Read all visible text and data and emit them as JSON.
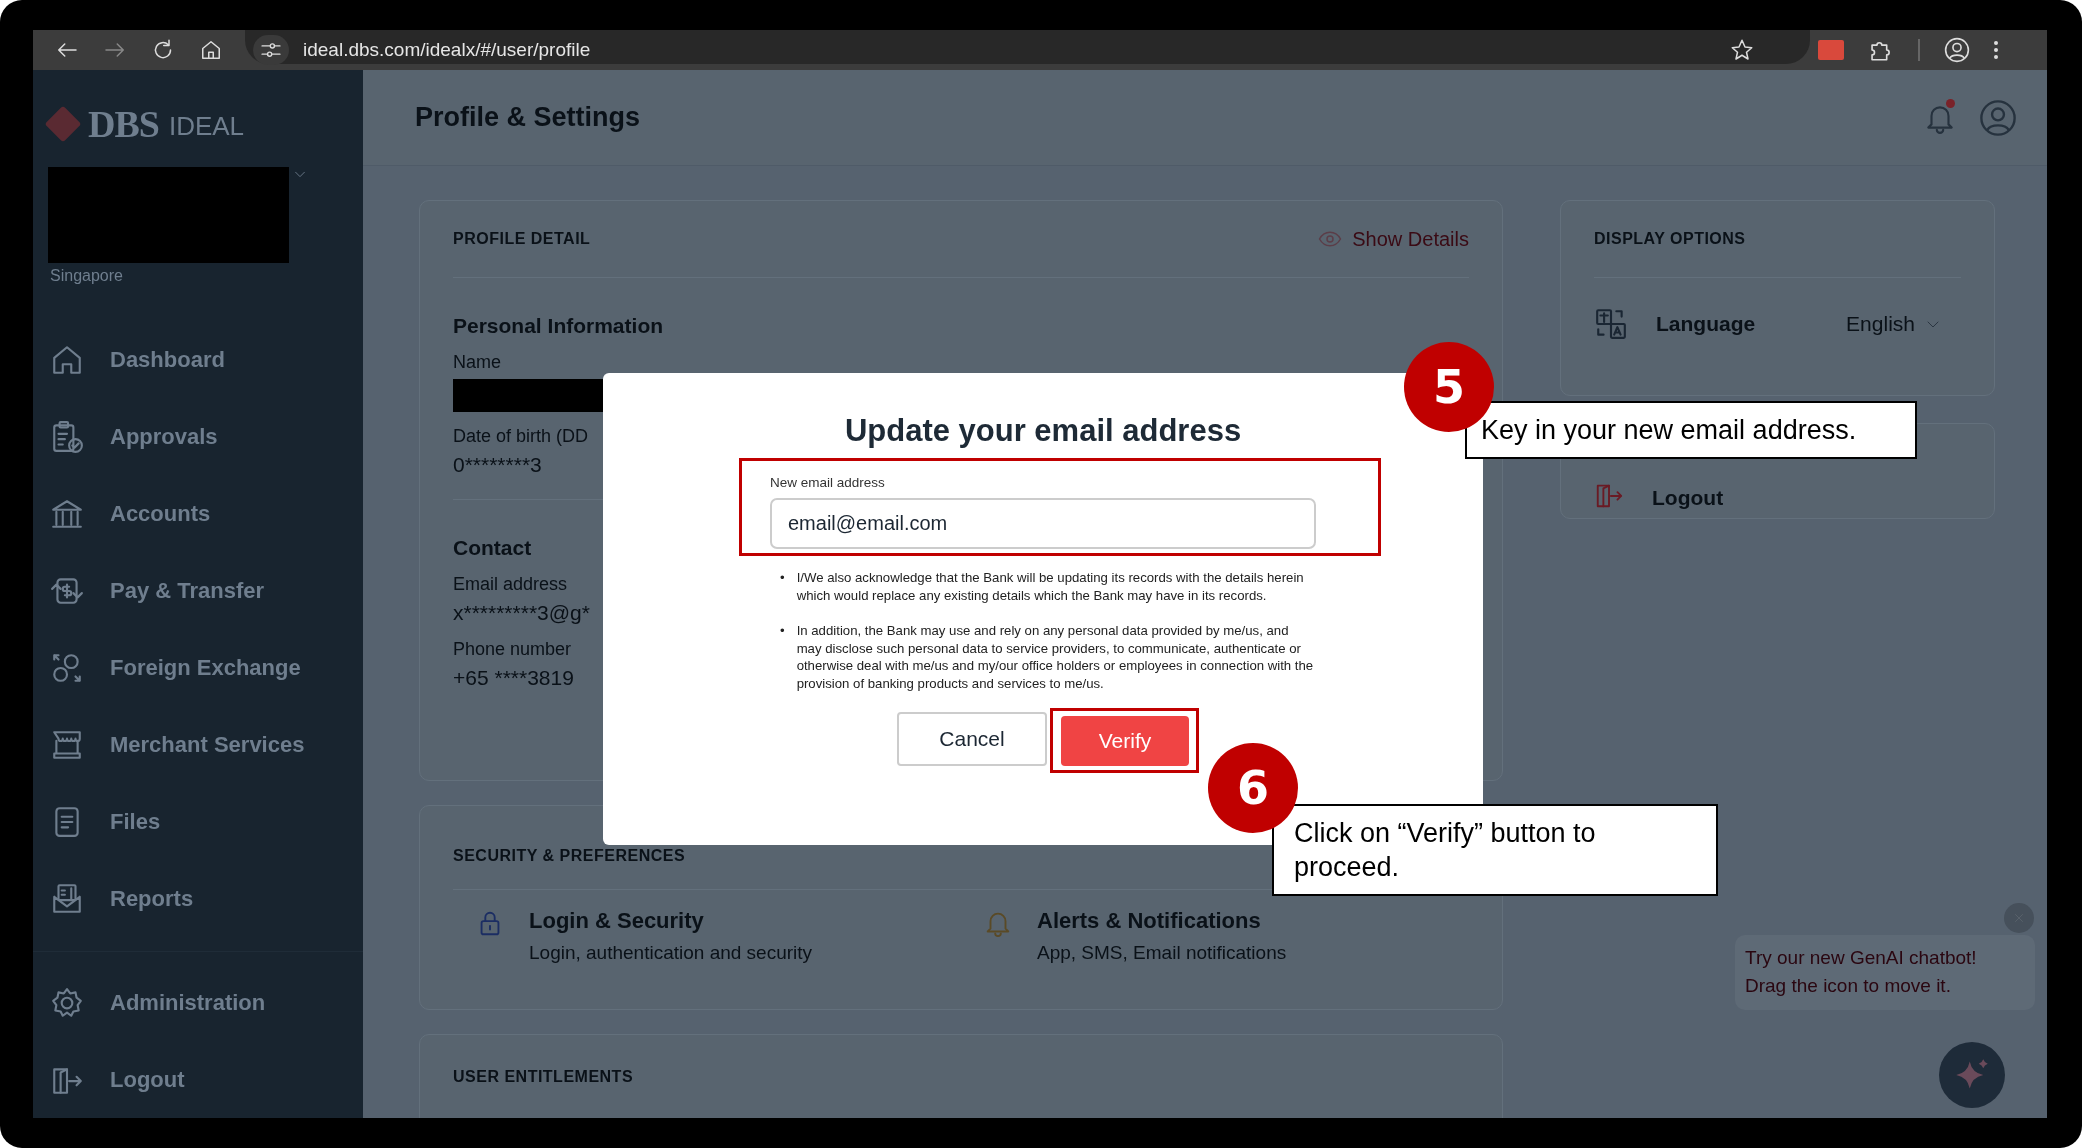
{
  "browser": {
    "url": "ideal.dbs.com/idealx/#/user/profile"
  },
  "sidebar": {
    "logo": {
      "brand": "DBS",
      "product": "IDEAL"
    },
    "account": {
      "redacted": true,
      "country": "Singapore"
    },
    "items": [
      {
        "label": "Dashboard"
      },
      {
        "label": "Approvals"
      },
      {
        "label": "Accounts"
      },
      {
        "label": "Pay & Transfer"
      },
      {
        "label": "Foreign Exchange"
      },
      {
        "label": "Merchant Services"
      },
      {
        "label": "Files"
      },
      {
        "label": "Reports"
      }
    ],
    "footer_items": [
      {
        "label": "Administration"
      },
      {
        "label": "Logout"
      }
    ]
  },
  "header": {
    "title": "Profile & Settings",
    "has_notification": true
  },
  "profile_card": {
    "title": "PROFILE DETAIL",
    "action": "Show Details",
    "groups": [
      {
        "title": "Personal Information",
        "fields": [
          {
            "label": "Name",
            "kind": "redacted"
          },
          {
            "label": "Date of birth (DD",
            "kind": "text",
            "value": "0********3"
          }
        ]
      },
      {
        "title": "Contact",
        "fields": [
          {
            "label": "Email address",
            "kind": "text",
            "value": "x*********3@g*"
          },
          {
            "label": "Phone number",
            "kind": "text",
            "value": "+65 ****3819"
          }
        ]
      }
    ]
  },
  "security_card": {
    "title": "SECURITY & PREFERENCES",
    "items": [
      {
        "title": "Login & Security",
        "subtitle": "Login, authentication and security"
      },
      {
        "title": "Alerts & Notifications",
        "subtitle": "App, SMS, Email notifications"
      }
    ]
  },
  "entitlements_card": {
    "title": "USER ENTITLEMENTS"
  },
  "display_card": {
    "title": "DISPLAY OPTIONS",
    "label": "Language",
    "value": "English"
  },
  "logout_card": {
    "label": "Logout"
  },
  "modal": {
    "title": "Update your email address",
    "field": {
      "label": "New email address",
      "value": "email@email.com"
    },
    "notes": [
      {
        "bullet": "•",
        "text": "I/We also acknowledge that the Bank will be updating its records with the details herein which would replace any existing details which the Bank may have in its records."
      },
      {
        "bullet": "•",
        "text": "In addition, the Bank may use and rely on any personal data provided by me/us, and may disclose such personal data to service providers, to communicate, authenticate or otherwise deal with me/us and my/our office holders or employees in connection with the provision of banking products and services to me/us."
      }
    ],
    "buttons": [
      {
        "label": "Cancel",
        "kind": "secondary"
      },
      {
        "label": "Verify",
        "kind": "primary"
      }
    ]
  },
  "annotations": [
    {
      "number": "5",
      "text": "Key in your new email address."
    },
    {
      "number": "6",
      "text": "Click on “Verify” button to proceed."
    }
  ],
  "chat": {
    "lines": [
      "Try our new GenAI chatbot!",
      "Drag the icon to move it."
    ]
  }
}
